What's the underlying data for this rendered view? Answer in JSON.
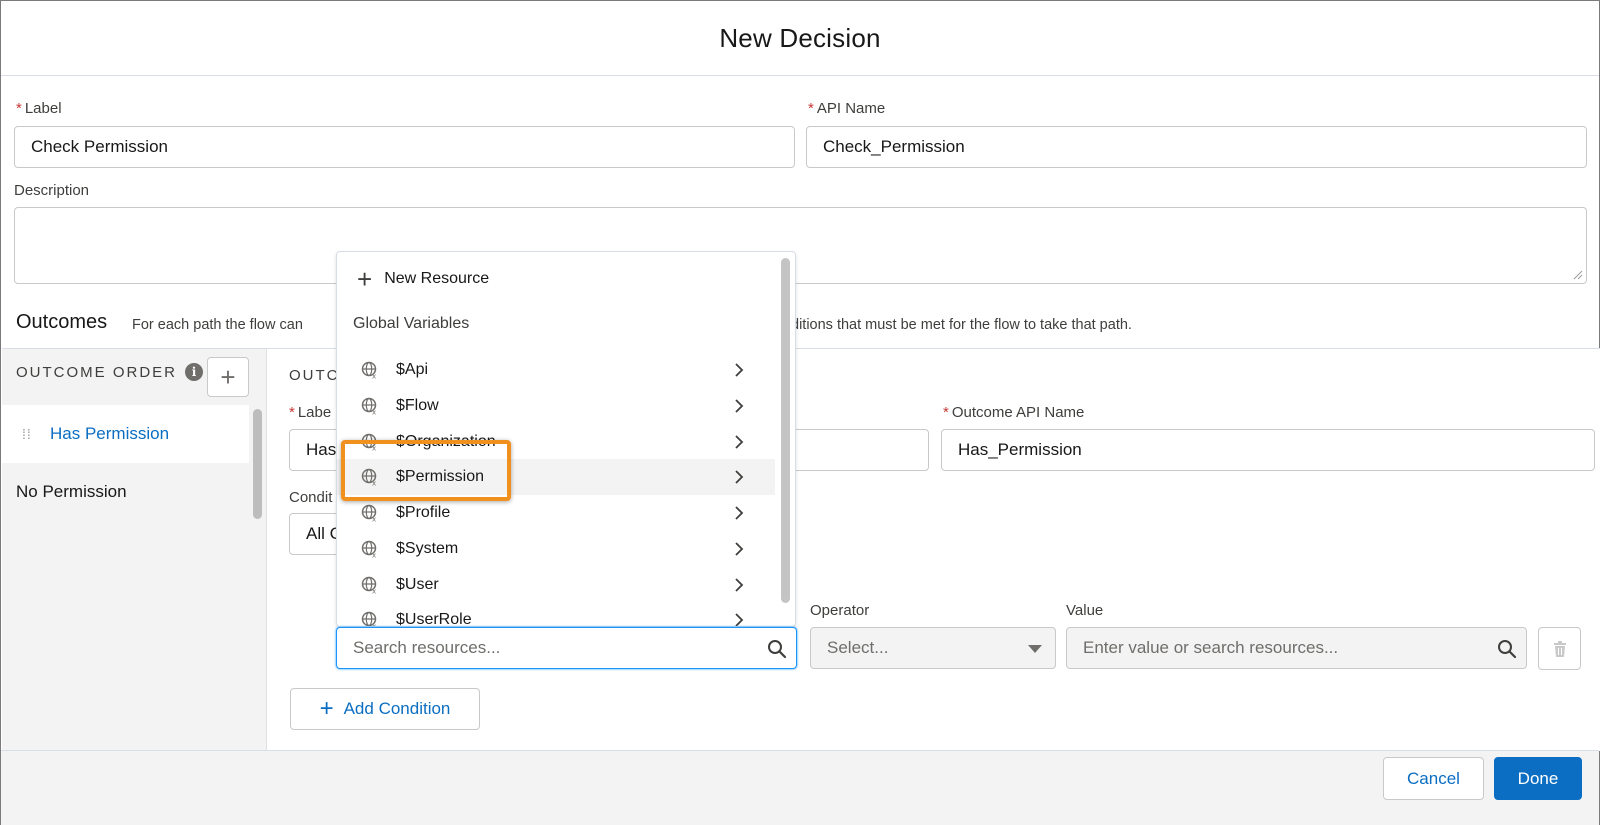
{
  "modal": {
    "title": "New Decision",
    "label_field": {
      "label": "Label",
      "value": "Check Permission",
      "required_mark": "*"
    },
    "api_name_field": {
      "label": "API Name",
      "value": "Check_Permission",
      "required_mark": "*"
    },
    "description_field": {
      "label": "Description",
      "value": ""
    }
  },
  "outcomes": {
    "title": "Outcomes",
    "description_left": "For each path the flow can",
    "description_right": "ditions that must be met for the flow to take that path.",
    "order_heading": "OUTCOME ORDER",
    "info_icon_glyph": "i",
    "add_glyph": "+",
    "items": [
      {
        "label": "Has Permission",
        "state": "selected"
      },
      {
        "label": "No Permission",
        "state": "default"
      }
    ]
  },
  "detail": {
    "section_heading_partial": "OUTC",
    "label_partial": "Labe",
    "label_value_partial": "Has",
    "outcome_api_name_label": "Outcome API Name",
    "outcome_api_name_value": "Has_Permission",
    "condition_label_partial": "Condit",
    "condition_value_partial": "All C",
    "operator_label": "Operator",
    "operator_placeholder": "Select...",
    "value_label": "Value",
    "value_placeholder": "Enter value or search resources...",
    "resource_placeholder": "Search resources...",
    "add_condition_label": "Add Condition",
    "add_condition_glyph": "+"
  },
  "resource_dropdown": {
    "new_resource_label": "New Resource",
    "new_resource_glyph": "+",
    "group_heading": "Global Variables",
    "items": [
      {
        "label": "$Api"
      },
      {
        "label": "$Flow"
      },
      {
        "label": "$Organization"
      },
      {
        "label": "$Permission",
        "highlighted": true
      },
      {
        "label": "$Profile"
      },
      {
        "label": "$System"
      },
      {
        "label": "$User"
      },
      {
        "label": "$UserRole"
      }
    ]
  },
  "footer": {
    "cancel_label": "Cancel",
    "done_label": "Done"
  },
  "colors": {
    "brand": "#0b6ec2",
    "required": "#c23934",
    "highlight_border": "#f0901e",
    "focus": "#1b96ff"
  },
  "icons": {
    "globe": "global-variable-icon",
    "chevron": "chevron-right-icon",
    "search": "search-icon",
    "trash": "trash-icon",
    "drag": "drag-handle-icon",
    "info": "info-icon"
  }
}
